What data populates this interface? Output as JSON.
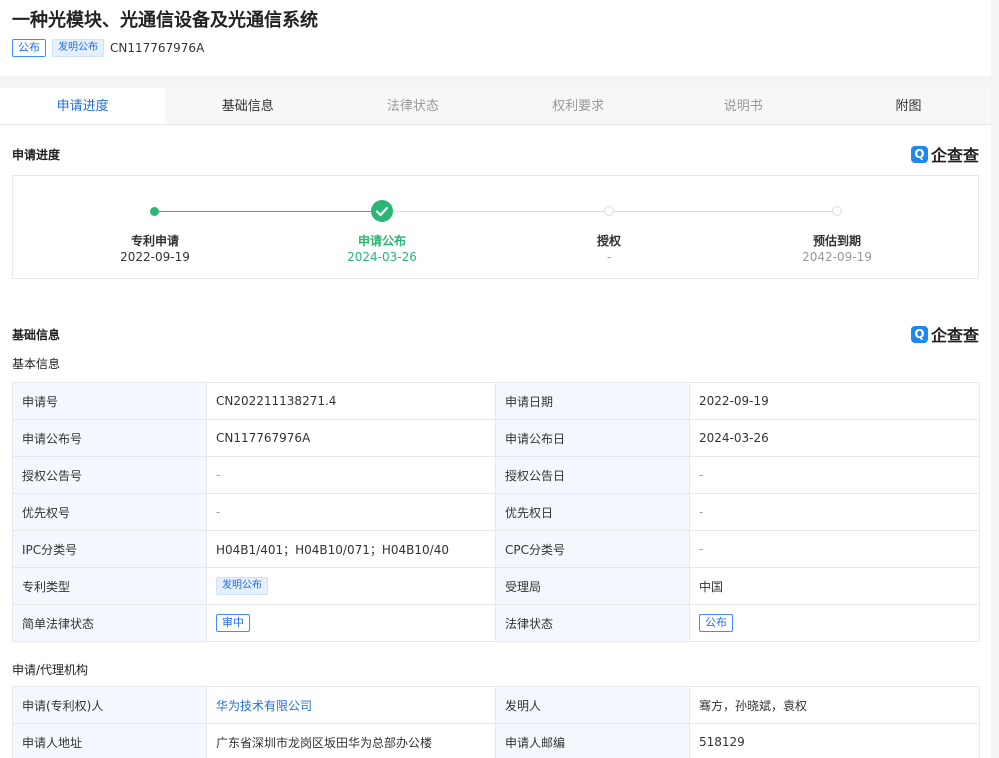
{
  "patent": {
    "title": "一种光模块、光通信设备及光通信系统",
    "tag1": "公布",
    "tag2": "发明公布",
    "pub_no": "CN117767976A"
  },
  "tabs": [
    "申请进度",
    "基础信息",
    "法律状态",
    "权利要求",
    "说明书",
    "附图"
  ],
  "progress": {
    "title": "申请进度",
    "logo_text": "企查查",
    "steps": [
      {
        "label": "专利申请",
        "date": "2022-09-19"
      },
      {
        "label": "申请公布",
        "date": "2024-03-26"
      },
      {
        "label": "授权",
        "date": "-"
      },
      {
        "label": "预估到期",
        "date": "2042-09-19"
      }
    ]
  },
  "basic": {
    "title": "基础信息",
    "logo_text": "企查查",
    "subtitle": "基本信息",
    "rows": [
      {
        "k1": "申请号",
        "v1": "CN202211138271.4",
        "k2": "申请日期",
        "v2": "2022-09-19"
      },
      {
        "k1": "申请公布号",
        "v1": "CN117767976A",
        "k2": "申请公布日",
        "v2": "2024-03-26"
      },
      {
        "k1": "授权公告号",
        "v1": "-",
        "k2": "授权公告日",
        "v2": "-"
      },
      {
        "k1": "优先权号",
        "v1": "-",
        "k2": "优先权日",
        "v2": "-"
      },
      {
        "k1": "IPC分类号",
        "v1": "H04B1/401；H04B10/071；H04B10/40",
        "k2": "CPC分类号",
        "v2": "-"
      },
      {
        "k1": "专利类型",
        "v1": "发明公布",
        "k2": "受理局",
        "v2": "中国"
      },
      {
        "k1": "简单法律状态",
        "v1": "审中",
        "k2": "法律状态",
        "v2": "公布"
      }
    ]
  },
  "agency": {
    "subtitle": "申请/代理机构",
    "rows": [
      {
        "k1": "申请(专利权)人",
        "v1": "华为技术有限公司",
        "k2": "发明人",
        "v2": "骞方，孙晓斌，袁权"
      },
      {
        "k1": "申请人地址",
        "v1": "广东省深圳市龙岗区坂田华为总部办公楼",
        "k2": "申请人邮编",
        "v2": "518129"
      }
    ]
  },
  "colors": {
    "accent": "#1e6fe0",
    "progress_green": "#2bb673",
    "pending": "#dddddd"
  }
}
